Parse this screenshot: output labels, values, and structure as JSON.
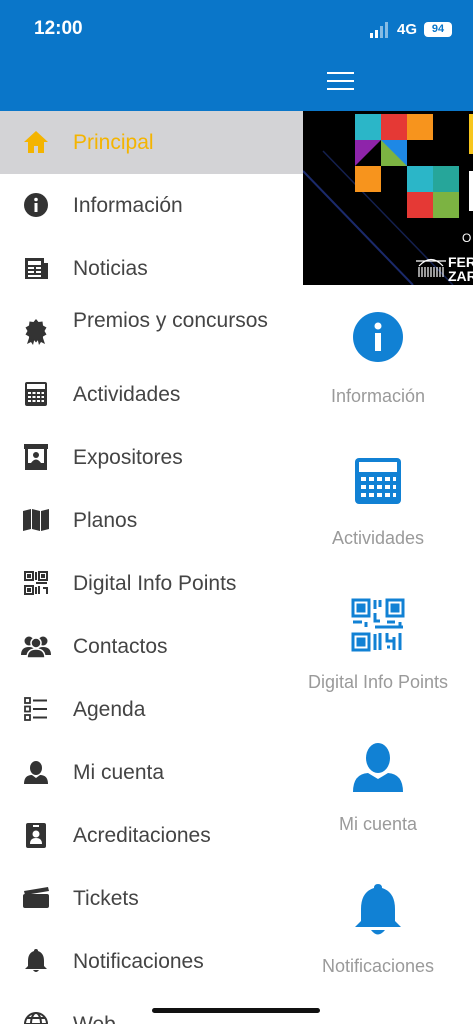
{
  "status": {
    "time": "12:00",
    "network": "4G",
    "battery": "94"
  },
  "menu": [
    {
      "label": "Principal",
      "icon": "home-icon",
      "active": true
    },
    {
      "label": "Información",
      "icon": "info-icon"
    },
    {
      "label": "Noticias",
      "icon": "newspaper-icon"
    },
    {
      "label": "Premios y concursos",
      "icon": "award-icon"
    },
    {
      "label": "Actividades",
      "icon": "calendar-icon"
    },
    {
      "label": "Expositores",
      "icon": "booth-icon"
    },
    {
      "label": "Planos",
      "icon": "map-icon"
    },
    {
      "label": "Digital Info Points",
      "icon": "qr-code-icon"
    },
    {
      "label": "Contactos",
      "icon": "contacts-icon"
    },
    {
      "label": "Agenda",
      "icon": "list-icon"
    },
    {
      "label": "Mi cuenta",
      "icon": "user-icon"
    },
    {
      "label": "Acreditaciones",
      "icon": "badge-icon"
    },
    {
      "label": "Tickets",
      "icon": "ticket-icon"
    },
    {
      "label": "Notificaciones",
      "icon": "bell-icon"
    },
    {
      "label": "Web",
      "icon": "globe-icon"
    }
  ],
  "banner": {
    "text1": "FER",
    "text2": "ZAR",
    "small": "O"
  },
  "tiles": [
    {
      "label": "Información",
      "icon": "info-icon"
    },
    {
      "label": "Actividades",
      "icon": "calendar-icon"
    },
    {
      "label": "Digital Info Points",
      "icon": "qr-code-icon"
    },
    {
      "label": "Mi cuenta",
      "icon": "user-icon"
    },
    {
      "label": "Notificaciones",
      "icon": "bell-icon"
    }
  ],
  "colors": {
    "header": "#0a76c9",
    "accent": "#f4b400",
    "tile_icon": "#1181d4",
    "active_bg": "#d3d3d6"
  }
}
